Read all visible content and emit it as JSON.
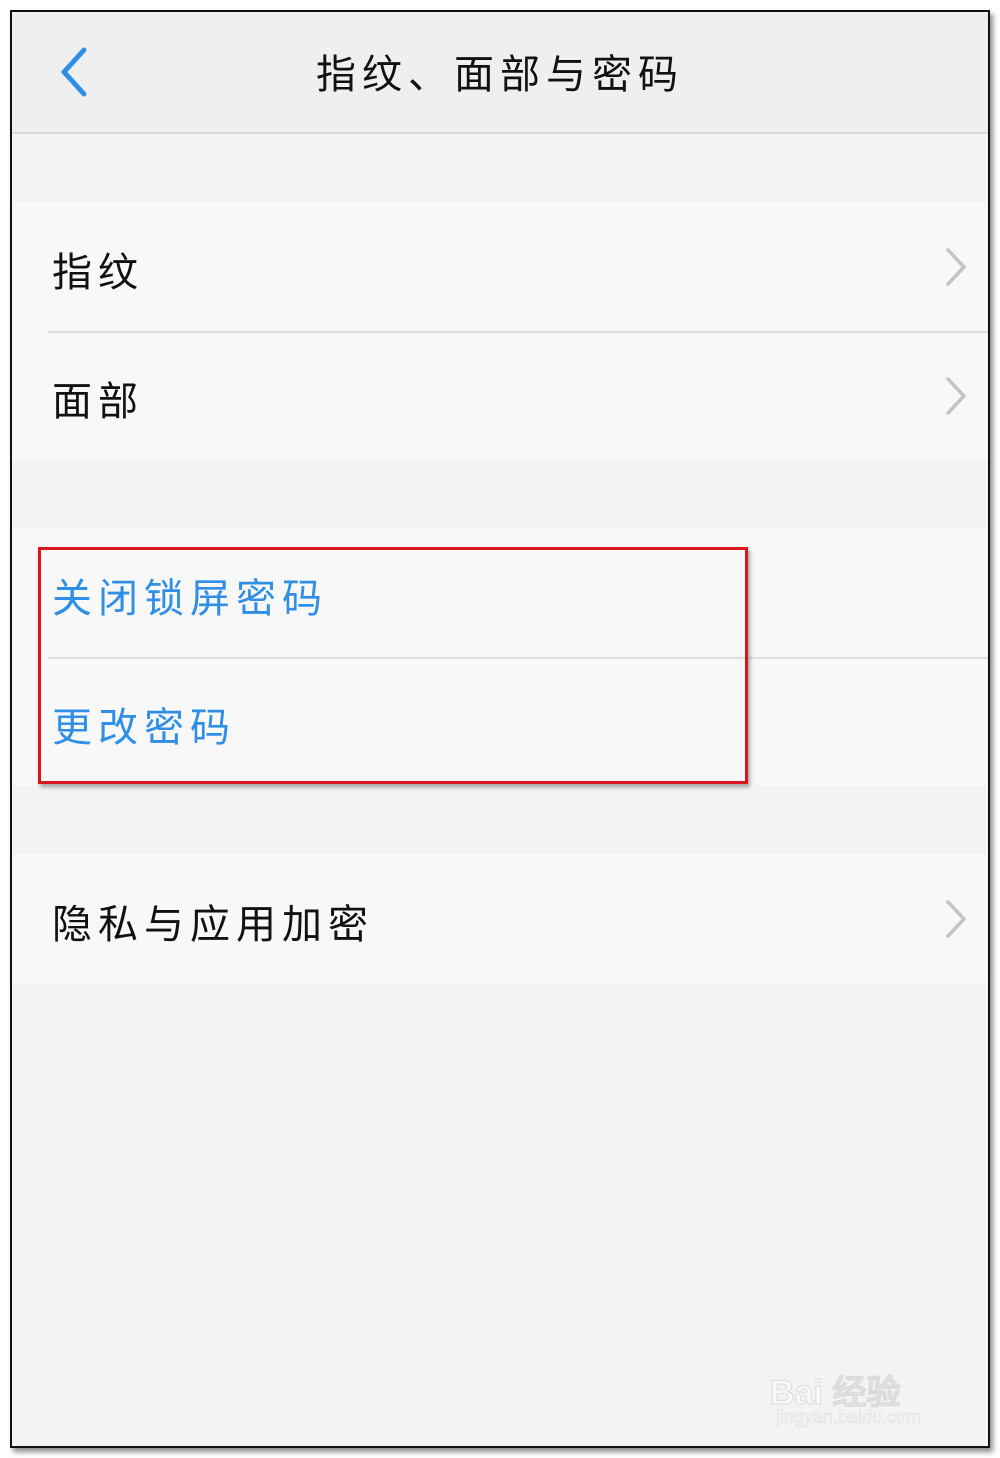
{
  "header": {
    "back_icon": "chevron-left-icon",
    "title": "指纹、面部与密码"
  },
  "biometrics_group": {
    "items": [
      {
        "label": "指纹",
        "icon": "chevron-right-icon"
      },
      {
        "label": "面部",
        "icon": "chevron-right-icon"
      }
    ]
  },
  "password_group": {
    "items": [
      {
        "label": "关闭锁屏密码"
      },
      {
        "label": "更改密码"
      }
    ]
  },
  "privacy_group": {
    "items": [
      {
        "label": "隐私与应用加密",
        "icon": "chevron-right-icon"
      }
    ]
  },
  "annotation": {
    "color": "#d9161e"
  },
  "watermark": {
    "main": "Bai 经验",
    "sub": "jingyan.baidu.com"
  },
  "colors": {
    "accent": "#2f8fe6",
    "text": "#111111",
    "background": "#f3f3f3",
    "row_background": "#f8f8f8"
  }
}
